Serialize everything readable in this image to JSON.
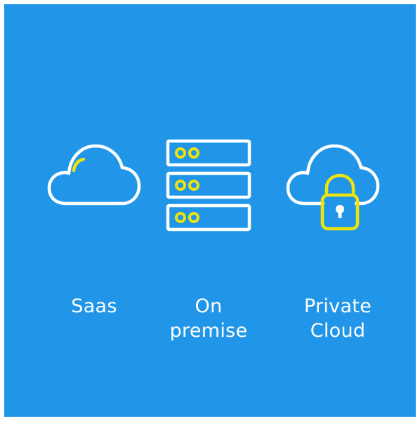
{
  "deployment_options": [
    {
      "id": "saas",
      "icon": "cloud-icon",
      "label_lines": [
        "Saas"
      ]
    },
    {
      "id": "on-premise",
      "icon": "server-rack-icon",
      "label_lines": [
        "On",
        "premise"
      ]
    },
    {
      "id": "private-cloud",
      "icon": "cloud-lock-icon",
      "label_lines": [
        "Private",
        "Cloud"
      ]
    }
  ],
  "colors": {
    "background": "#2196e8",
    "stroke": "#ffffff",
    "accent": "#f0e30c"
  }
}
